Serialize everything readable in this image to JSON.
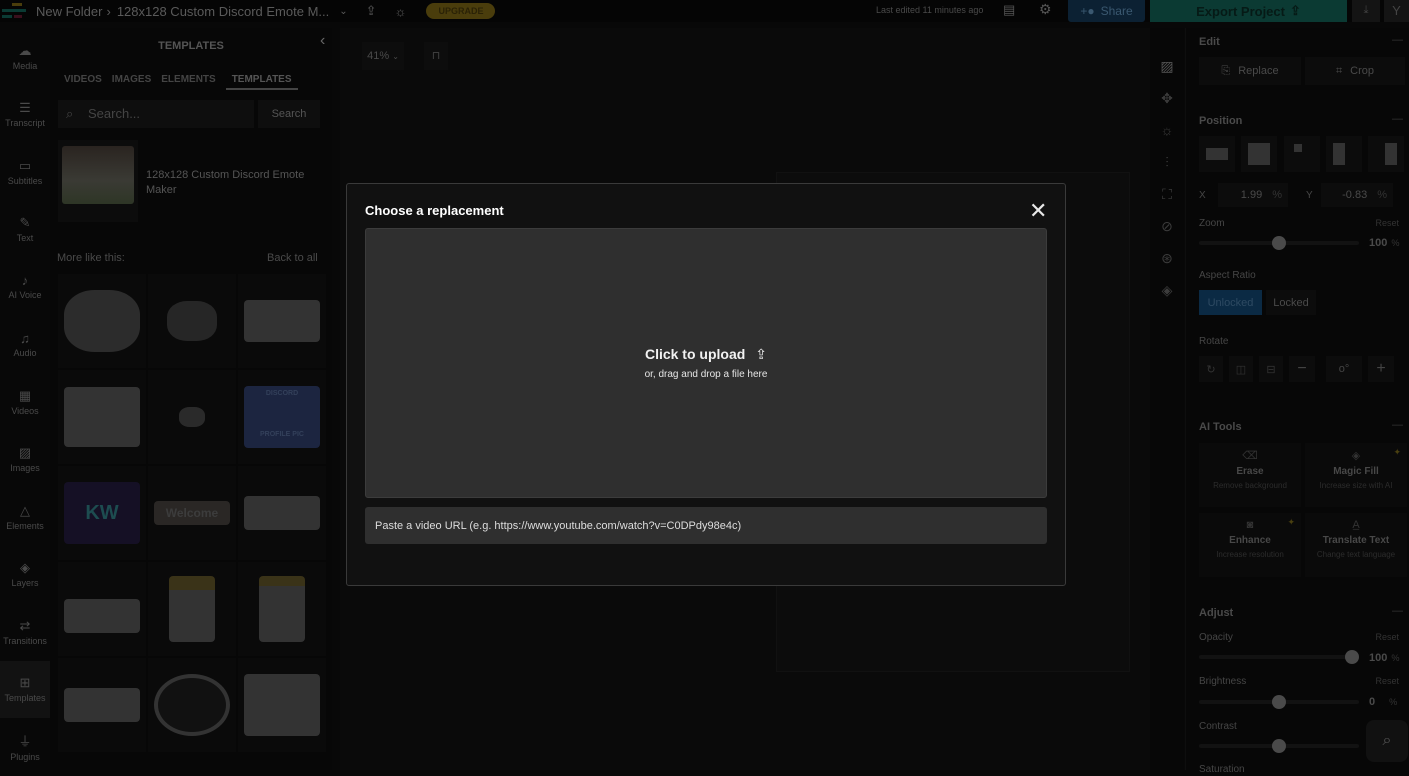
{
  "topbar": {
    "folder": "New Folder",
    "project": "128x128 Custom Discord Emote M...",
    "upgrade": "UPGRADE",
    "last_edited": "Last edited 11 minutes ago",
    "share": "Share",
    "export": "Export Project",
    "avatar": "Y"
  },
  "rail": [
    {
      "label": "Media",
      "icon": "☁"
    },
    {
      "label": "Transcript",
      "icon": "☰"
    },
    {
      "label": "Subtitles",
      "icon": "▭"
    },
    {
      "label": "Text",
      "icon": "✎"
    },
    {
      "label": "AI Voice",
      "icon": "♪"
    },
    {
      "label": "Audio",
      "icon": "♫"
    },
    {
      "label": "Videos",
      "icon": "▦"
    },
    {
      "label": "Images",
      "icon": "▨"
    },
    {
      "label": "Elements",
      "icon": "△"
    },
    {
      "label": "Layers",
      "icon": "◈"
    },
    {
      "label": "Transitions",
      "icon": "⇄"
    },
    {
      "label": "Templates",
      "icon": "⊞"
    },
    {
      "label": "Plugins",
      "icon": "⏚"
    }
  ],
  "panel": {
    "title": "TEMPLATES",
    "tabs": [
      "VIDEOS",
      "IMAGES",
      "ELEMENTS",
      "TEMPLATES"
    ],
    "search_placeholder": "Search...",
    "search_button": "Search",
    "featured_title": "128x128 Custom Discord Emote Maker",
    "more_like_this": "More like this:",
    "back_to_all": "Back to all",
    "discord_label": "DISCORD",
    "discord_sub": "PROFILE PIC",
    "kw": "KW",
    "welcome": "Welcome"
  },
  "canvas": {
    "zoom": "41%"
  },
  "right": {
    "edit": "Edit",
    "replace": "Replace",
    "crop": "Crop",
    "position": "Position",
    "x_label": "X",
    "x": "1.99",
    "y_label": "Y",
    "y": "-0.83",
    "pct": "%",
    "zoom": "Zoom",
    "reset": "Reset",
    "zoom_val": "100",
    "zoom_level": 0.5,
    "aspect": "Aspect Ratio",
    "unlocked": "Unlocked",
    "locked": "Locked",
    "rotate": "Rotate",
    "ai_tools": "AI Tools",
    "ai": [
      {
        "t": "Erase",
        "s": "Remove background"
      },
      {
        "t": "Magic Fill",
        "s": "Increase size with AI"
      },
      {
        "t": "Enhance",
        "s": "Increase resolution"
      },
      {
        "t": "Translate Text",
        "s": "Change text language"
      }
    ],
    "adjust": "Adjust",
    "opacity": "Opacity",
    "opacity_val": "100",
    "brightness": "Brightness",
    "brightness_val": "0",
    "contrast": "Contrast",
    "saturation": "Saturation"
  },
  "modal": {
    "title": "Choose a replacement",
    "upload": "Click to upload",
    "drag": "or, drag and drop a file here",
    "url_placeholder": "Paste a video URL (e.g. https://www.youtube.com/watch?v=C0DPdy98e4c)"
  },
  "colors": {
    "share": "#0c2133",
    "export": "#0b3a33",
    "upgrade": "#4a3d0c",
    "unlocked": "#0b2a44"
  }
}
